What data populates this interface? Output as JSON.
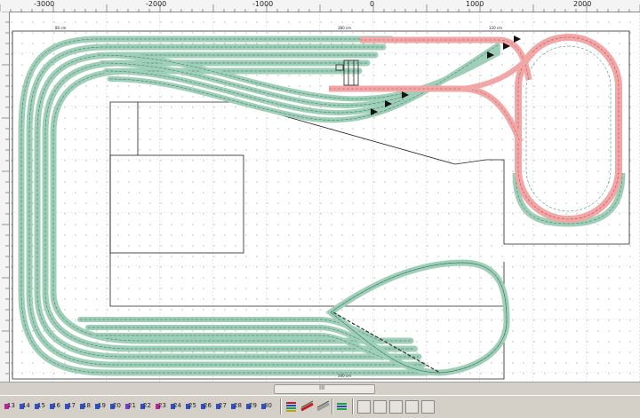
{
  "ruler": {
    "labels": [
      "-3000",
      "-2000",
      "-1000",
      "0",
      "1000",
      "2000"
    ]
  },
  "layout": {
    "dimension_labels": [
      "80 cm",
      "120 cm",
      "380 cm",
      "340 cm"
    ]
  },
  "scrollbar": {
    "grip_label": "III"
  },
  "toolbar": {
    "layers": [
      "13",
      "14",
      "15",
      "16",
      "17",
      "18",
      "19",
      "20",
      "21",
      "22",
      "23",
      "24",
      "25",
      "26",
      "27",
      "28",
      "29",
      "30"
    ],
    "layer_colors": [
      "#c0209a",
      "#3050c8",
      "#3050c8",
      "#3050c8",
      "#3050c8",
      "#3050c8",
      "#3050c8",
      "#3050c8",
      "#7a3ad0",
      "#3050c8",
      "#c0209a",
      "#3050c8",
      "#3050c8",
      "#3050c8",
      "#3050c8",
      "#3050c8",
      "#3050c8",
      "#3050c8"
    ],
    "tool_icons": [
      "layers-stack-icon",
      "rail-red-icon",
      "rail-gray-icon",
      "layers-green-icon"
    ],
    "nav_icons": [
      "nav-first-icon",
      "nav-prev-icon",
      "nav-up-icon",
      "nav-next-icon",
      "nav-last-icon"
    ]
  },
  "colors": {
    "track_green": "#9fcfb8",
    "track_red": "#f2a6a6",
    "grid": "#7a7a7a"
  }
}
